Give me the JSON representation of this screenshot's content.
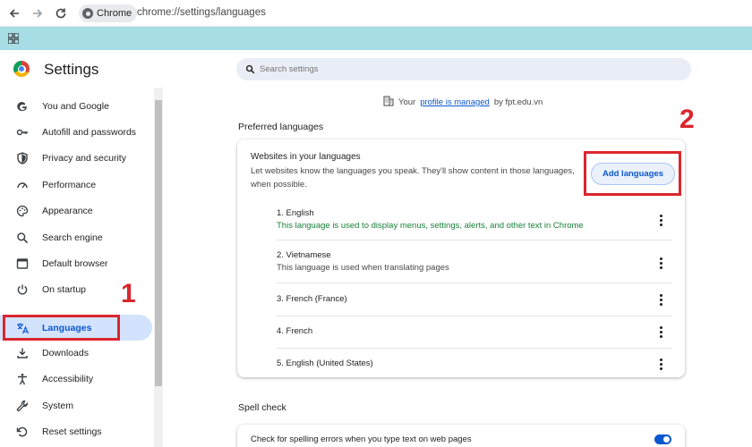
{
  "browser": {
    "chip_label": "Chrome",
    "url": "chrome://settings/languages"
  },
  "sidebar": {
    "title": "Settings",
    "items": [
      {
        "label": "You and Google",
        "icon": "google-icon"
      },
      {
        "label": "Autofill and passwords",
        "icon": "key-icon"
      },
      {
        "label": "Privacy and security",
        "icon": "shield-icon"
      },
      {
        "label": "Performance",
        "icon": "gauge-icon"
      },
      {
        "label": "Appearance",
        "icon": "palette-icon"
      },
      {
        "label": "Search engine",
        "icon": "search-icon"
      },
      {
        "label": "Default browser",
        "icon": "browser-icon"
      },
      {
        "label": "On startup",
        "icon": "power-icon"
      },
      {
        "label": "Languages",
        "icon": "translate-icon",
        "active": true
      },
      {
        "label": "Downloads",
        "icon": "download-icon"
      },
      {
        "label": "Accessibility",
        "icon": "accessibility-icon"
      },
      {
        "label": "System",
        "icon": "wrench-icon"
      },
      {
        "label": "Reset settings",
        "icon": "reset-icon"
      }
    ]
  },
  "search": {
    "placeholder": "Search settings"
  },
  "managed": {
    "prefix": "Your",
    "link": "profile is managed",
    "suffix": "by fpt.edu.vn"
  },
  "preferred": {
    "heading": "Preferred languages",
    "card_title": "Websites in your languages",
    "card_desc": "Let websites know the languages you speak. They'll show content in those languages, when possible.",
    "add_button": "Add languages",
    "languages": [
      {
        "name": "1. English",
        "sub": "This language is used to display menus, settings, alerts, and other text in Chrome",
        "sub_color": "#188038"
      },
      {
        "name": "2. Vietnamese",
        "sub": "This language is used when translating pages",
        "sub_color": "#474747"
      },
      {
        "name": "3. French (France)"
      },
      {
        "name": "4. French"
      },
      {
        "name": "5. English (United States)"
      }
    ]
  },
  "spell_check": {
    "heading": "Spell check",
    "option": "Check for spelling errors when you type text on web pages",
    "enabled": true
  },
  "annotations": {
    "step1": "1",
    "step2": "2",
    "color": "#d9262d"
  }
}
